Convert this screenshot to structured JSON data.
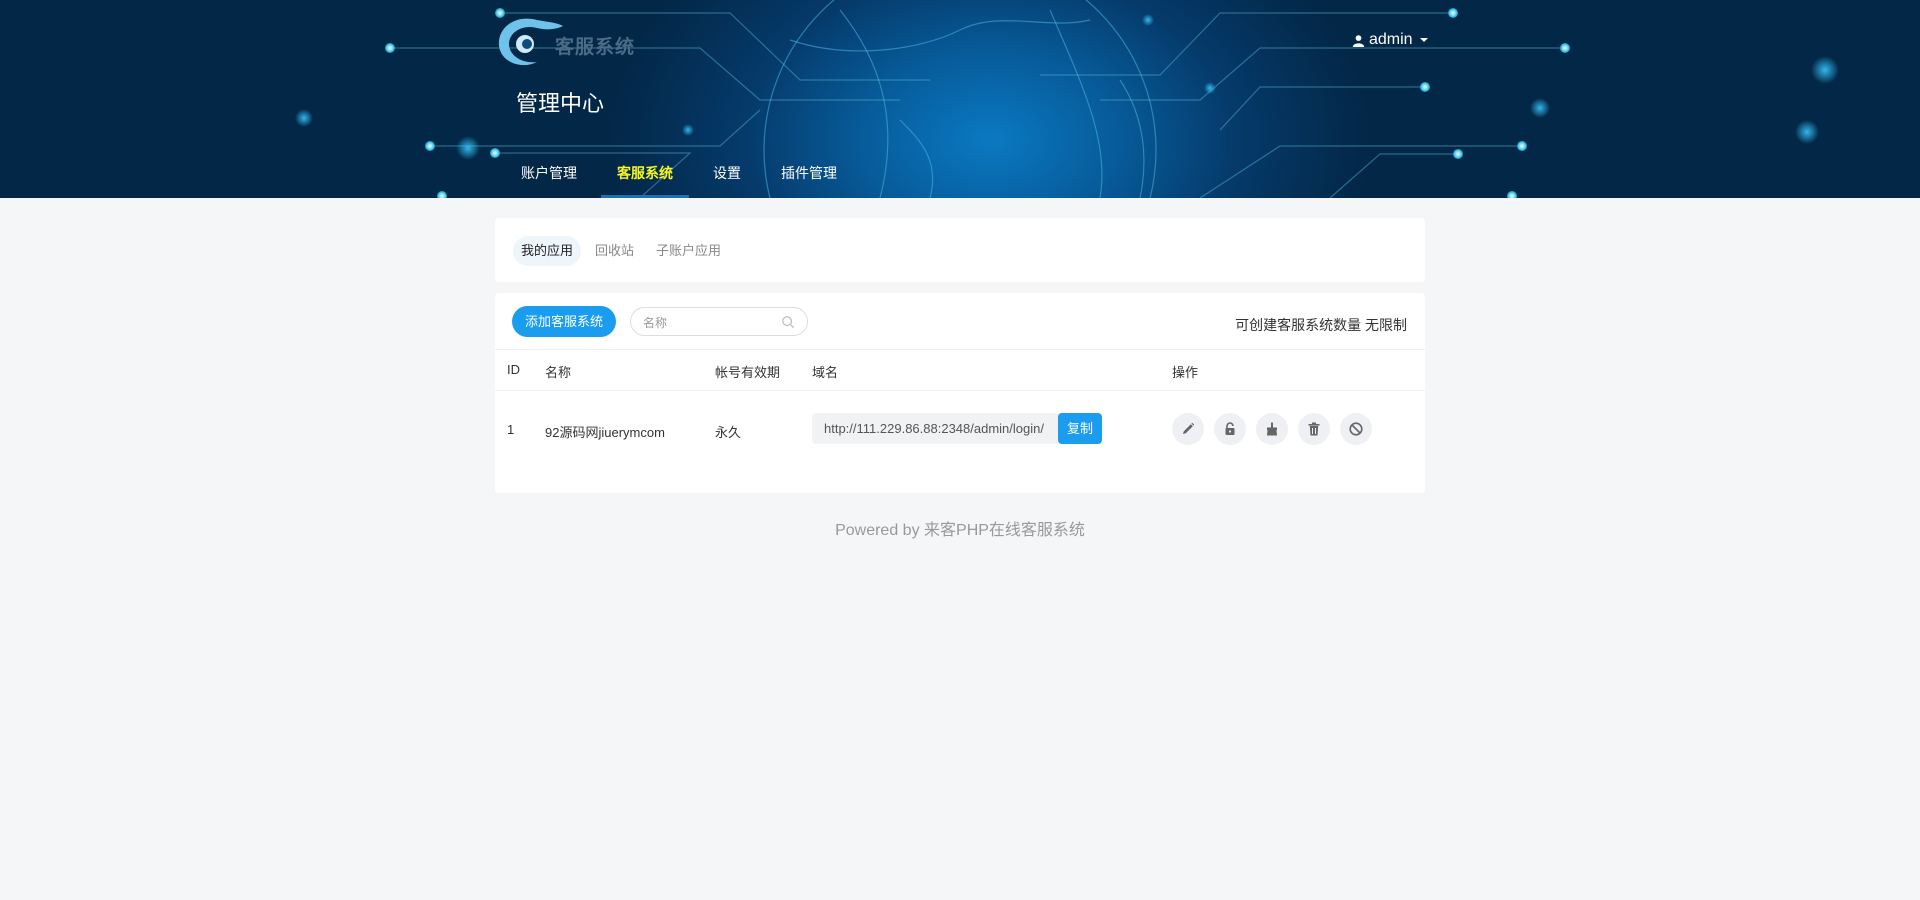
{
  "header": {
    "logo_text": "客服系统",
    "title": "管理中心",
    "user_name": "admin",
    "nav": [
      {
        "label": "账户管理"
      },
      {
        "label": "客服系统"
      },
      {
        "label": "设置"
      },
      {
        "label": "插件管理"
      }
    ]
  },
  "tabs": [
    {
      "label": "我的应用"
    },
    {
      "label": "回收站"
    },
    {
      "label": "子账户应用"
    }
  ],
  "toolbar": {
    "add_label": "添加客服系统",
    "search_placeholder": "名称",
    "quota_text": "可创建客服系统数量 无限制"
  },
  "table": {
    "headers": {
      "id": "ID",
      "name": "名称",
      "expiry": "帐号有效期",
      "domain": "域名",
      "ops": "操作"
    },
    "rows": [
      {
        "id": "1",
        "name": "92源码网jiuerymcom",
        "expiry": "永久",
        "domain": "http://111.229.86.88:2348/admin/login/",
        "copy_label": "复制"
      }
    ]
  },
  "icons": [
    "edit-icon",
    "unlock-icon",
    "clear-icon",
    "delete-icon",
    "ban-icon"
  ],
  "colors": {
    "accent": "#1a9dee",
    "nav_active": "#f7f720",
    "header_bg": "#053a6a"
  },
  "footer": "Powered by 来客PHP在线客服系统"
}
